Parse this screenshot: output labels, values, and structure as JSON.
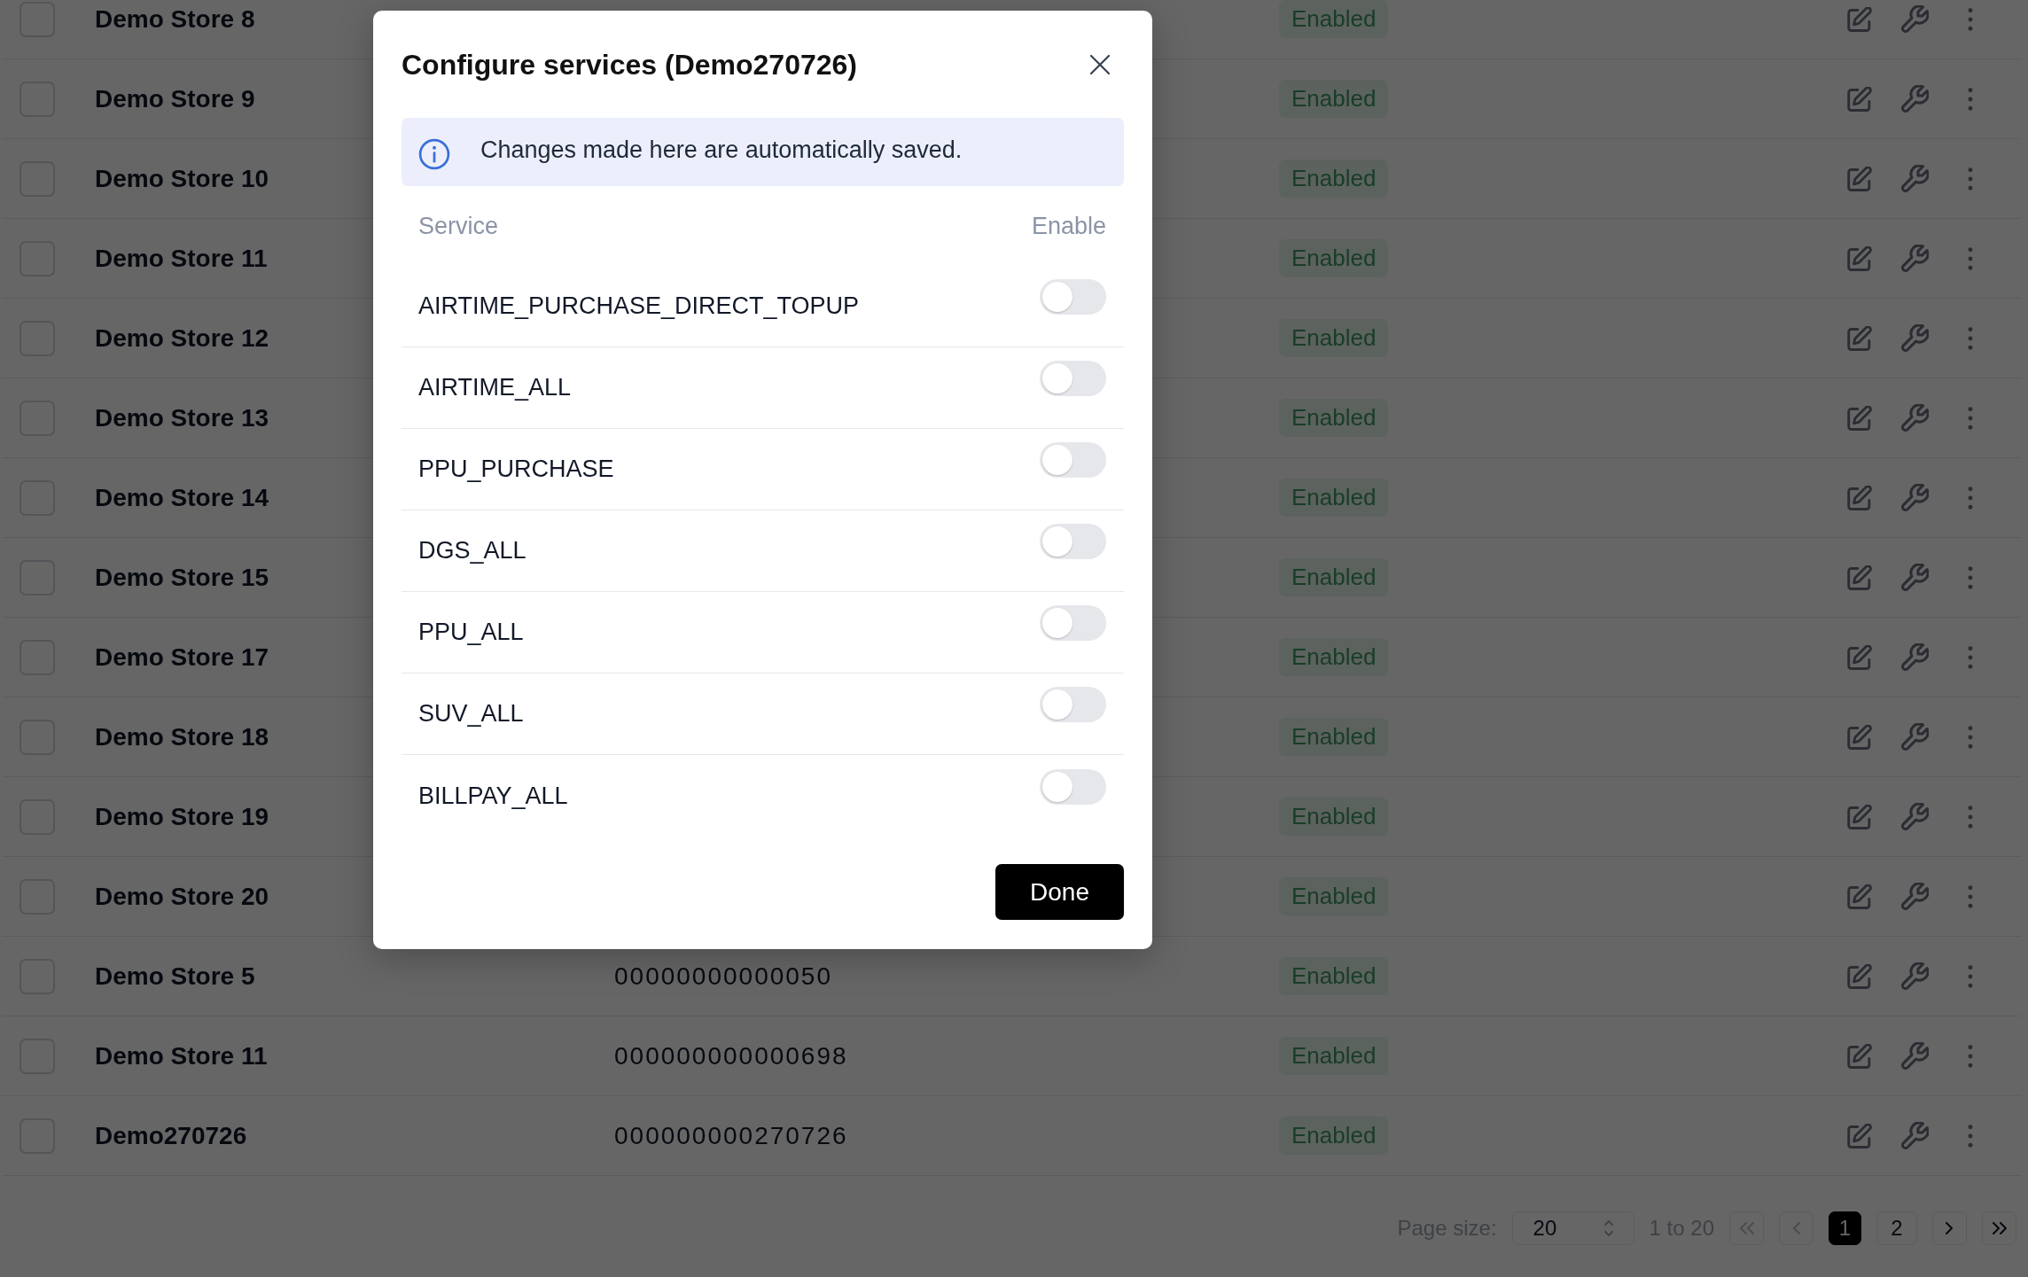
{
  "table": {
    "rows": [
      {
        "name": "Demo Store 8",
        "checked": false,
        "status": "Enabled"
      },
      {
        "name": "Demo Store 9",
        "checked": false,
        "status": "Enabled"
      },
      {
        "name": "Demo Store 10",
        "checked": false,
        "status": "Enabled"
      },
      {
        "name": "Demo Store 11",
        "checked": false,
        "status": "Enabled"
      },
      {
        "name": "Demo Store 12",
        "checked": false,
        "status": "Enabled"
      },
      {
        "name": "Demo Store 13",
        "checked": false,
        "status": "Enabled"
      },
      {
        "name": "Demo Store 14",
        "checked": false,
        "status": "Enabled"
      },
      {
        "name": "Demo Store 15",
        "checked": false,
        "status": "Enabled"
      },
      {
        "name": "Demo Store 17",
        "checked": false,
        "status": "Enabled"
      },
      {
        "name": "Demo Store 18",
        "checked": false,
        "status": "Enabled"
      },
      {
        "name": "Demo Store 19",
        "checked": false,
        "status": "Enabled"
      },
      {
        "name": "Demo Store 20",
        "checked": false,
        "status": "Enabled"
      },
      {
        "name": "Demo Store 5",
        "number": "00000000000050",
        "checked": false,
        "status": "Enabled"
      },
      {
        "name": "Demo Store 11",
        "number": "000000000000698",
        "checked": false,
        "status": "Enabled"
      },
      {
        "name": "Demo270726",
        "number": "000000000270726",
        "checked": false,
        "status": "Enabled"
      }
    ]
  },
  "pagination": {
    "page_size_label": "Page size:",
    "page_size": "20",
    "range": "1 to 20",
    "nav_before": [
      {
        "kind": "first",
        "disabled": true
      },
      {
        "kind": "previous",
        "disabled": true
      }
    ],
    "pages": [
      {
        "label": "1",
        "selected": true
      },
      {
        "label": "2",
        "selected": false
      }
    ],
    "nav_after": [
      {
        "kind": "next",
        "disabled": false
      },
      {
        "kind": "last",
        "disabled": false
      }
    ]
  },
  "dialog": {
    "title": "Configure services (Demo270726)",
    "notice": "Changes made here are automatically saved.",
    "columns": [
      "Service",
      "Enable"
    ],
    "services": [
      {
        "name": "AIRTIME_PURCHASE_DIRECT_TOPUP",
        "on": false
      },
      {
        "name": "AIRTIME_ALL",
        "on": false
      },
      {
        "name": "PPU_PURCHASE",
        "on": false
      },
      {
        "name": "DGS_ALL",
        "on": false
      },
      {
        "name": "PPU_ALL",
        "on": false
      },
      {
        "name": "SUV_ALL",
        "on": false
      },
      {
        "name": "BILLPAY_ALL",
        "on": false
      }
    ],
    "done_button": "Done"
  }
}
